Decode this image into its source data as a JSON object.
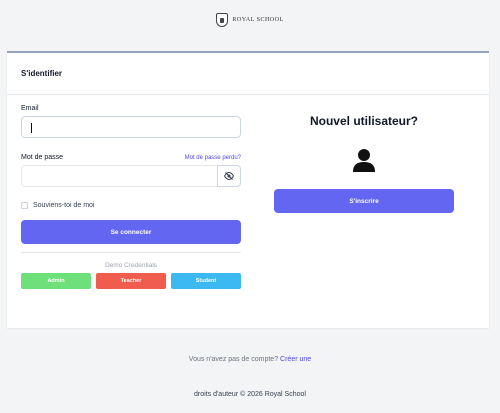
{
  "brand": {
    "name": "ROYAL SCHOOL",
    "tagline": ""
  },
  "login": {
    "title": "S'identifier",
    "email_label": "Email",
    "email_value": "",
    "password_label": "Mot de passe",
    "password_value": "",
    "forgot_label": "Mot de passe perdu?",
    "remember_label": "Souviens-toi de moi",
    "submit_label": "Se connecter",
    "demo_title": "Demo Credentials",
    "demo_buttons": [
      {
        "label": "Admin",
        "color": "#6ee07a"
      },
      {
        "label": "Teacher",
        "color": "#f05d4f"
      },
      {
        "label": "Student",
        "color": "#3bb9f0"
      }
    ]
  },
  "register": {
    "title": "Nouvel utilisateur?",
    "icon": "user-icon",
    "button_label": "S'inscrire"
  },
  "signup": {
    "prompt": "Vous n'avez pas de compte?",
    "link": "Créer une"
  },
  "footer": {
    "text": "droits d'auteur © 2026 Royal School"
  },
  "colors": {
    "primary": "#6366f1",
    "link": "#4f46e5",
    "background": "#f3f4f6"
  }
}
